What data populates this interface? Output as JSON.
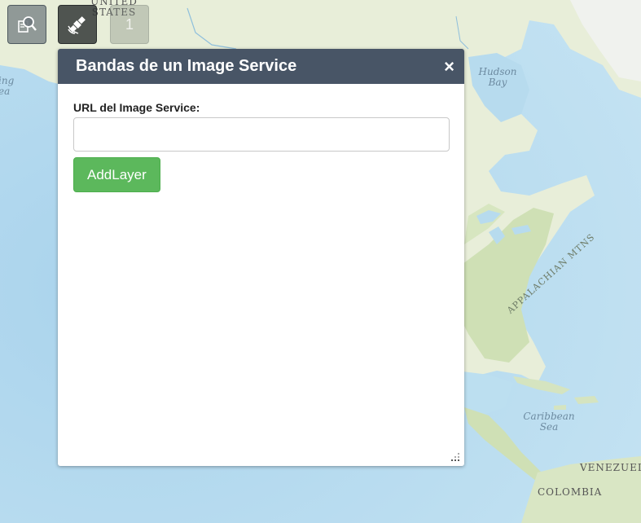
{
  "map": {
    "labels": {
      "united_states": "UNITED STATES",
      "hudson_bay": "Hudson Bay",
      "bering_sea": "ing ea",
      "appalachian": "APPALACHIAN MTNS",
      "caribbean": "Caribbean Sea",
      "venezuela": "VENEZUEL",
      "colombia": "COLOMBIA"
    },
    "colors": {
      "ocean": "#b9dcef",
      "land": "#e7edd8",
      "green": "#c7dbb0"
    }
  },
  "toolbar": {
    "buttons": [
      {
        "icon": "search-report-icon"
      },
      {
        "icon": "satellite-icon"
      },
      {
        "icon": "layer-count-icon",
        "text": "1"
      }
    ]
  },
  "panel": {
    "title": "Bandas de un Image Service",
    "close_label": "×",
    "url_label": "URL del Image Service:",
    "url_value": "",
    "url_placeholder": "",
    "add_button_label": "AddLayer"
  },
  "colors": {
    "header_bg": "#485566",
    "button_green": "#5cb85c"
  }
}
